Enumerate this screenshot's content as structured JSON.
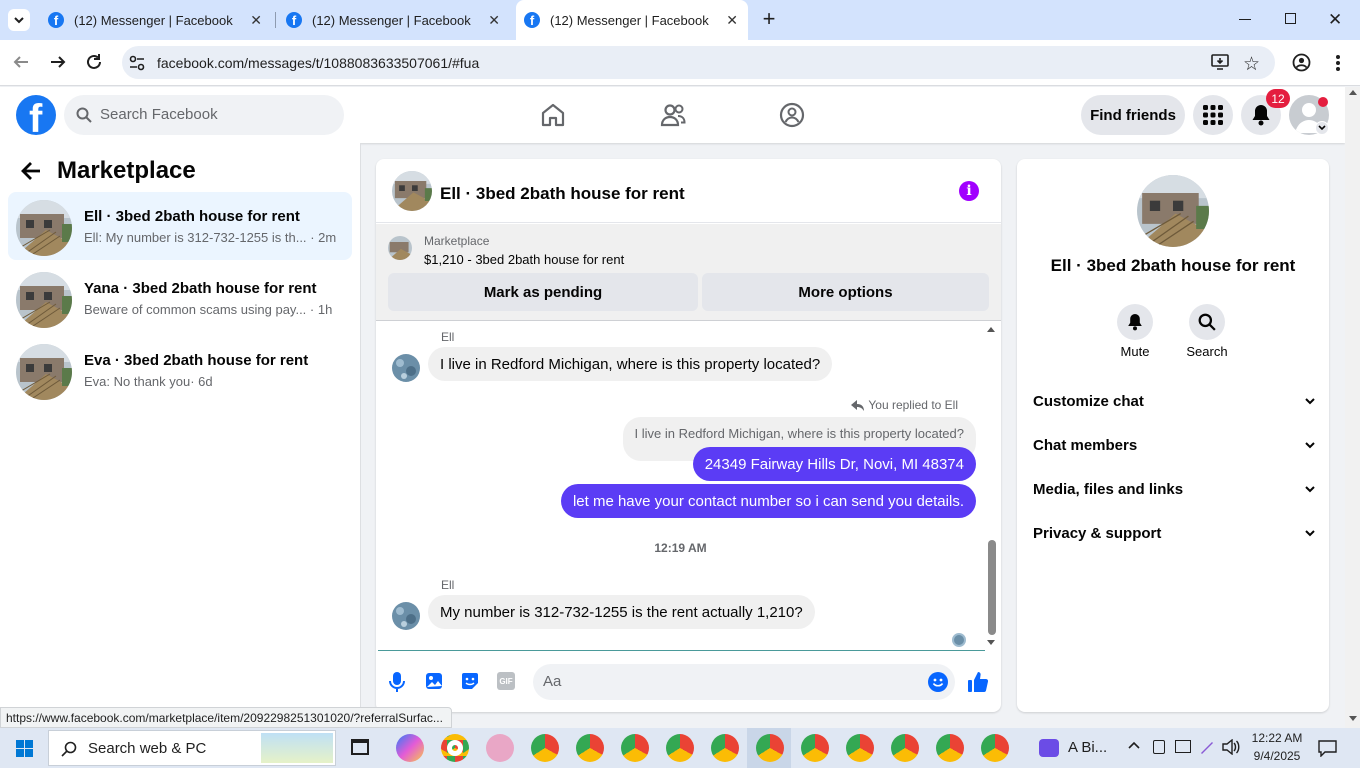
{
  "browser": {
    "tabs": [
      {
        "title": "(12) Messenger | Facebook"
      },
      {
        "title": "(12) Messenger | Facebook"
      },
      {
        "title": "(12) Messenger | Facebook"
      }
    ],
    "url": "facebook.com/messages/t/1088083633507061/#fua",
    "status_url": "https://www.facebook.com/marketplace/item/2092298251301020/?referralSurfac..."
  },
  "fb_header": {
    "search_placeholder": "Search Facebook",
    "find_friends": "Find friends",
    "notification_count": "12"
  },
  "sidebar": {
    "title": "Marketplace",
    "conversations": [
      {
        "name": "Ell · 3bed 2bath house for rent",
        "preview": "Ell: My number is 312-732-1255 is th...",
        "time": "· 2m"
      },
      {
        "name": "Yana · 3bed 2bath house for rent",
        "preview": "Beware of common scams using pay...",
        "time": "· 1h"
      },
      {
        "name": "Eva · 3bed 2bath house for rent",
        "preview": "Eva: No thank you",
        "time": "· 6d"
      }
    ]
  },
  "chat": {
    "title": "Ell · 3bed 2bath house for rent",
    "listing_label": "Marketplace",
    "listing_desc": "$1,210 - 3bed 2bath house for rent",
    "mark_pending": "Mark as pending",
    "more_options": "More options",
    "messages": {
      "sender1": "Ell",
      "msg1": "I live in Redford Michigan, where is this property located?",
      "replied_to": "You replied to Ell",
      "quoted": "I live in Redford Michigan, where is this property located?",
      "out1": "24349 Fairway Hills Dr, Novi, MI 48374",
      "out2": "let me have your contact number so i can send you details.",
      "timestamp": "12:19 AM",
      "sender2": "Ell",
      "msg2": "My number is 312-732-1255 is the rent actually 1,210?"
    },
    "composer_placeholder": "Aa"
  },
  "right_panel": {
    "name": "Ell · 3bed 2bath house for rent",
    "mute": "Mute",
    "search": "Search",
    "sections": [
      "Customize chat",
      "Chat members",
      "Media, files and links",
      "Privacy & support"
    ]
  },
  "taskbar": {
    "search_placeholder": "Search web & PC",
    "app_label": "A Bi...",
    "time": "12:22 AM",
    "date": "9/4/2025"
  },
  "colors": {
    "facebook_blue": "#1877f2",
    "outgoing_bubble": "#5b3cf5",
    "selected_conv": "#ebf5ff",
    "notification_badge": "#e41e3f"
  }
}
